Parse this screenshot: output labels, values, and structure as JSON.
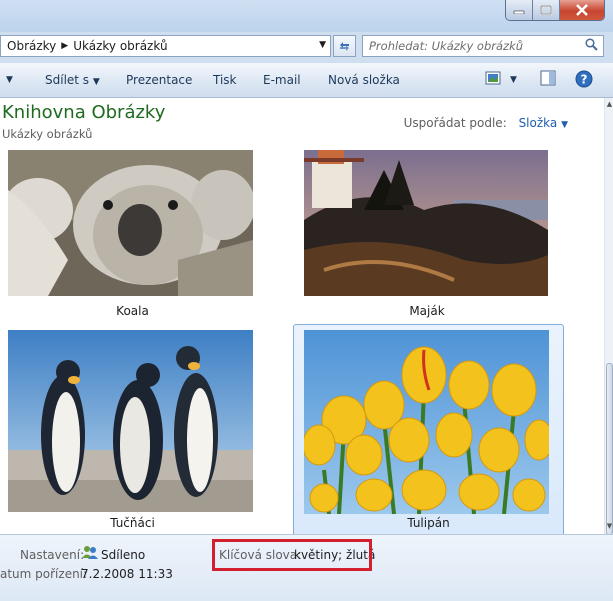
{
  "address": {
    "crumbs": [
      "Obrázky",
      "Ukázky obrázků"
    ],
    "search_placeholder": "Prohledat: Ukázky obrázků"
  },
  "toolbar": {
    "share_label": "Sdílet s",
    "slideshow_label": "Prezentace",
    "print_label": "Tisk",
    "email_label": "E-mail",
    "new_folder_label": "Nová složka"
  },
  "library": {
    "title": "Knihovna Obrázky",
    "subtitle": "Ukázky obrázků",
    "arrange_label": "Uspořádat podle:",
    "arrange_value": "Složka"
  },
  "items": [
    {
      "name": "Koala",
      "selected": false
    },
    {
      "name": "Maják",
      "selected": false
    },
    {
      "name": "Tučňáci",
      "selected": false
    },
    {
      "name": "Tulipán",
      "selected": true
    }
  ],
  "details": {
    "settings_label": "Nastavení:",
    "settings_value": "Sdíleno",
    "date_label": "atum pořízení:",
    "date_value": "7.2.2008 11:33",
    "keywords_label": "Klíčová slova:",
    "keywords_value": "květiny; žlutá"
  },
  "colors": {
    "library_title": "#1e6a1e",
    "highlight_box": "#d2202e",
    "link_blue": "#1f5fb0"
  }
}
